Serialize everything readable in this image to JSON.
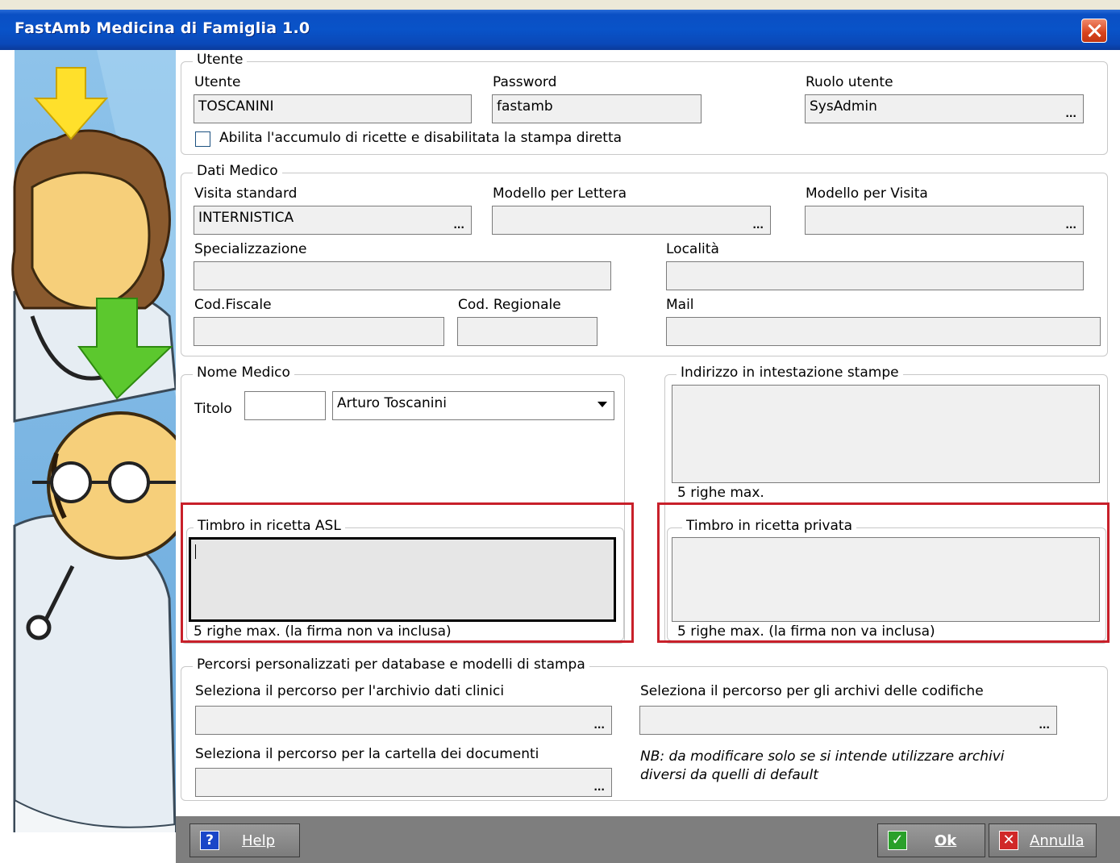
{
  "window": {
    "title": "FastAmb Medicina di Famiglia 1.0"
  },
  "utente": {
    "group_label": "Utente",
    "utente_label": "Utente",
    "utente_value": "TOSCANINI",
    "password_label": "Password",
    "password_value": "fastamb",
    "ruolo_label": "Ruolo utente",
    "ruolo_value": "SysAdmin",
    "checkbox_label": "Abilita l'accumulo di ricette e disabilitata la stampa diretta",
    "checkbox_checked": false
  },
  "dati_medico": {
    "group_label": "Dati Medico",
    "visita_standard_label": "Visita standard",
    "visita_standard_value": "INTERNISTICA",
    "modello_lettera_label": "Modello per Lettera",
    "modello_lettera_value": "",
    "modello_visita_label": "Modello per Visita",
    "modello_visita_value": "",
    "specializzazione_label": "Specializzazione",
    "localita_label": "Località",
    "cod_fiscale_label": "Cod.Fiscale",
    "cod_regionale_label": "Cod. Regionale",
    "mail_label": "Mail"
  },
  "nome_medico": {
    "group_label": "Nome Medico",
    "titolo_label": "Titolo",
    "titolo_value": "",
    "nome_value": "Arturo Toscanini"
  },
  "indirizzo": {
    "group_label": "Indirizzo in intestazione stampe",
    "hint": "5 righe max."
  },
  "timbro_asl": {
    "group_label": "Timbro in ricetta ASL",
    "hint": "5 righe max. (la firma non va inclusa)"
  },
  "timbro_privata": {
    "group_label": "Timbro in ricetta privata",
    "hint": "5 righe max. (la firma non va inclusa)"
  },
  "percorsi": {
    "group_label": "Percorsi personalizzati per database e modelli di stampa",
    "archivio_clinici_label": "Seleziona il percorso per l'archivio dati clinici",
    "archivi_codifiche_label": "Seleziona il percorso per gli archivi delle codifiche",
    "cartella_documenti_label": "Seleziona il percorso per la cartella dei documenti",
    "note": "NB: da modificare solo se si intende utilizzare archivi diversi da quelli di default"
  },
  "buttons": {
    "help": "Help",
    "ok": "Ok",
    "annulla": "Annulla"
  },
  "ellipsis": "...",
  "colors": {
    "titlebar": "#0953c8",
    "highlight": "#c8202a",
    "bottombar": "#7e7e7e"
  }
}
